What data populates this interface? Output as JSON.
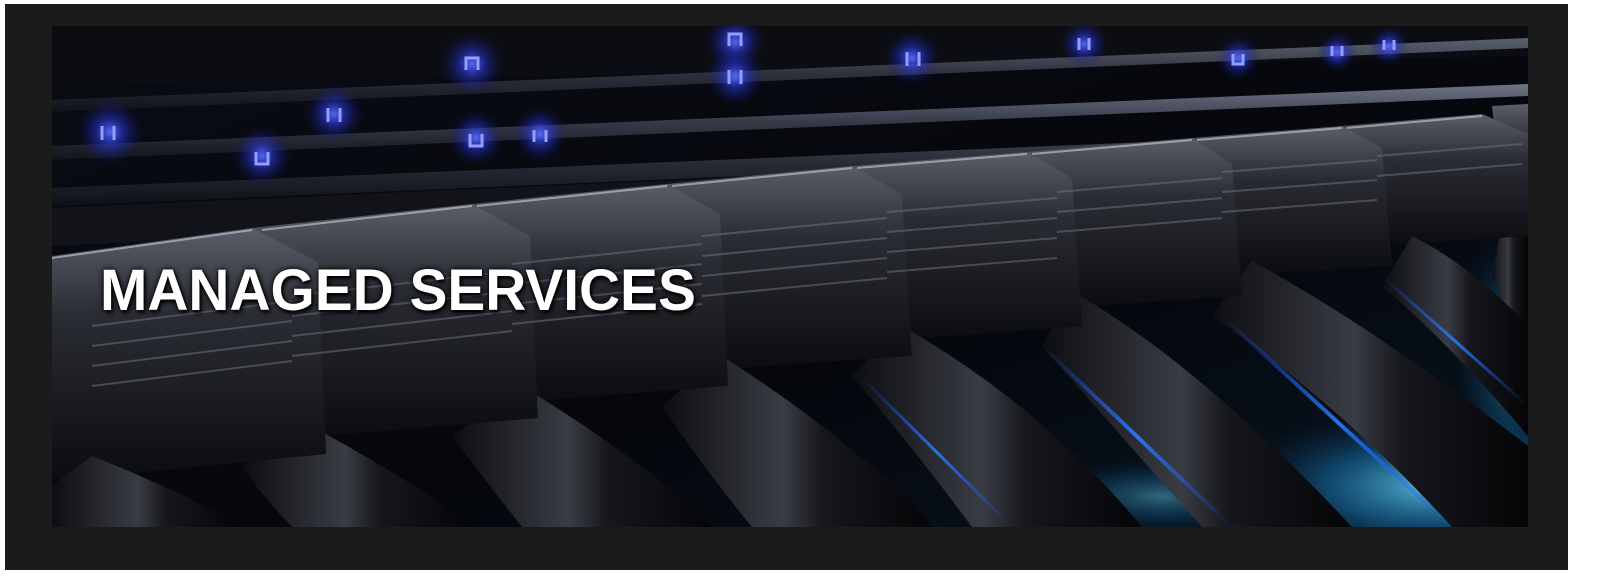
{
  "banner": {
    "headline": "MANAGED SERVICES",
    "image_subject": "network-switch-ethernet-cables"
  },
  "colors": {
    "frame": "#1b1b1b",
    "led_blue": "#3d4dff",
    "cable_glow": "#1fb8ff",
    "headline": "#ffffff"
  }
}
